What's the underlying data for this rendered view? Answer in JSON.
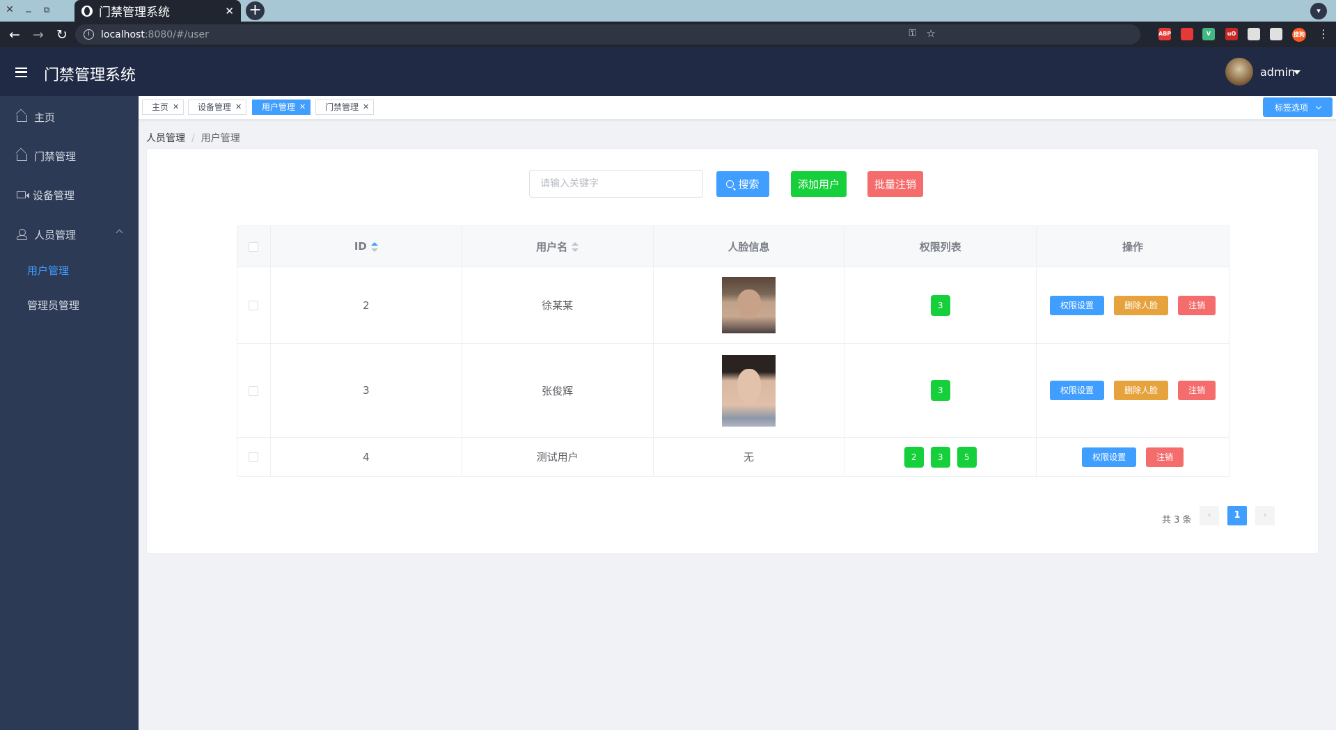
{
  "browser": {
    "tab_title": "门禁管理系统",
    "url_host": "localhost",
    "url_rest": ":8080/#/user",
    "extensions": [
      {
        "name": "abp-icon",
        "label": "ABP",
        "color": "#e53935"
      },
      {
        "name": "ext-red-icon",
        "label": "",
        "color": "#e53935"
      },
      {
        "name": "vue-icon",
        "label": "V",
        "color": "#42b883"
      },
      {
        "name": "ublock-icon",
        "label": "uO",
        "color": "#c62828"
      },
      {
        "name": "page-icon",
        "label": "",
        "color": "#e0e0e0"
      },
      {
        "name": "puzzle-icon",
        "label": "",
        "color": "#e0e0e0"
      },
      {
        "name": "translate-icon",
        "label": "搜狗",
        "color": "#ff5a1f"
      }
    ]
  },
  "header": {
    "title": "门禁管理系统",
    "username": "admin"
  },
  "sidebar": {
    "items": [
      {
        "label": "主页"
      },
      {
        "label": "门禁管理"
      },
      {
        "label": "设备管理"
      },
      {
        "label": "人员管理"
      }
    ],
    "sub_items": [
      {
        "label": "用户管理",
        "active": true
      },
      {
        "label": "管理员管理",
        "active": false
      }
    ]
  },
  "tags": {
    "items": [
      {
        "label": "主页",
        "active": false
      },
      {
        "label": "设备管理",
        "active": false
      },
      {
        "label": "用户管理",
        "active": true
      },
      {
        "label": "门禁管理",
        "active": false
      }
    ],
    "options_label": "标签选项"
  },
  "breadcrumb": [
    "人员管理",
    "用户管理"
  ],
  "toolbar": {
    "search_placeholder": "请输入关键字",
    "search_label": "搜索",
    "add_label": "添加用户",
    "batch_delete_label": "批量注销"
  },
  "table": {
    "headers": [
      "ID",
      "用户名",
      "人脸信息",
      "权限列表",
      "操作"
    ],
    "rows": [
      {
        "id": "2",
        "username": "徐某某",
        "face": "photo",
        "perms": [
          "3"
        ],
        "actions": [
          "权限设置",
          "删除人脸",
          "注销"
        ]
      },
      {
        "id": "3",
        "username": "张俊辉",
        "face": "photo",
        "perms": [
          "3"
        ],
        "actions": [
          "权限设置",
          "删除人脸",
          "注销"
        ]
      },
      {
        "id": "4",
        "username": "测试用户",
        "face": "无",
        "perms": [
          "2",
          "3",
          "5"
        ],
        "actions": [
          "权限设置",
          "注销"
        ]
      }
    ]
  },
  "pagination": {
    "total_label": "共 3 条",
    "current_page": "1",
    "prev": "‹",
    "next": "›"
  }
}
